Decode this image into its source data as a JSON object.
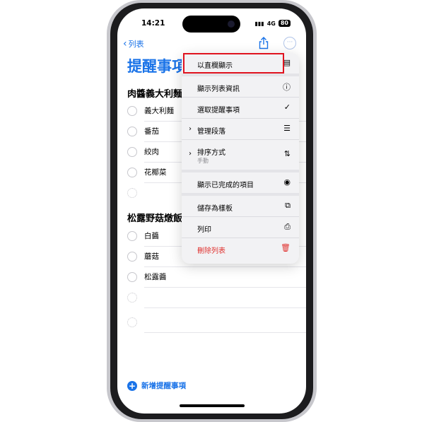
{
  "status": {
    "time": "14:21",
    "network": "4G",
    "battery": "80"
  },
  "nav": {
    "back_label": "列表"
  },
  "page": {
    "title": "提醒事項"
  },
  "sections": [
    {
      "title": "肉醬義大利麵",
      "items": [
        "義大利麵",
        "番茄",
        "絞肉",
        "花椰菜"
      ]
    },
    {
      "title": "松露野菇燉飯",
      "items": [
        "白醬",
        "蘑菇",
        "松露醬"
      ]
    }
  ],
  "new_reminder": {
    "label": "新增提醒事項"
  },
  "menu": {
    "items": [
      {
        "label": "以直欄顯示",
        "icon": "columns-icon"
      },
      {
        "label": "顯示列表資訊",
        "icon": "info-icon"
      },
      {
        "label": "選取提醒事項",
        "icon": "checkmark-circle-icon"
      },
      {
        "label": "管理段落",
        "icon": "list-lines-icon"
      },
      {
        "label": "排序方式",
        "sublabel": "手動",
        "icon": "sort-arrows-icon"
      },
      {
        "label": "顯示已完成的項目",
        "icon": "eye-icon"
      },
      {
        "label": "儲存為樣板",
        "icon": "duplicate-icon"
      },
      {
        "label": "列印",
        "icon": "printer-icon"
      },
      {
        "label": "刪除列表",
        "icon": "trash-icon"
      }
    ]
  },
  "colors": {
    "accent": "#1a73e8",
    "destructive": "#e0312e",
    "highlight": "#e0131f"
  }
}
